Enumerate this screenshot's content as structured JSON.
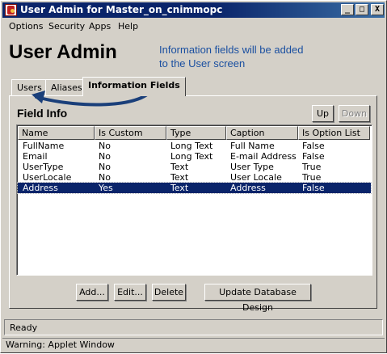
{
  "window": {
    "title": "User Admin for Master_on_cnimmopc",
    "minimize_glyph": "_",
    "maximize_glyph": "□",
    "close_glyph": "X"
  },
  "menu": [
    "Options",
    "Security",
    "Apps",
    "Help"
  ],
  "heading": "User Admin",
  "annotation": "Information fields will be added to the User screen",
  "tabs": [
    {
      "label": "Users",
      "active": false
    },
    {
      "label": "Aliases",
      "active": false
    },
    {
      "label": "Information Fields",
      "active": true
    }
  ],
  "panel": {
    "title": "Field Info",
    "up_label": "Up",
    "down_label": "Down"
  },
  "table": {
    "columns": [
      "Name",
      "Is Custom",
      "Type",
      "Caption",
      "Is Option List"
    ],
    "rows": [
      [
        "FullName",
        "No",
        "Long Text",
        "Full Name",
        "False"
      ],
      [
        "Email",
        "No",
        "Long Text",
        "E-mail Address",
        "False"
      ],
      [
        "UserType",
        "No",
        "Text",
        "User Type",
        "True"
      ],
      [
        "UserLocale",
        "No",
        "Text",
        "User Locale",
        "True"
      ],
      [
        "Address",
        "Yes",
        "Text",
        "Address",
        "False"
      ]
    ],
    "selected_row": 4
  },
  "buttons": {
    "add": "Add...",
    "edit": "Edit...",
    "delete": "Delete",
    "update": "Update Database Design"
  },
  "status": "Ready",
  "warning": "Warning: Applet Window",
  "colors": {
    "title_bar": "#0a246a",
    "selection": "#0a246a",
    "annotation": "#1a4fa0",
    "face": "#d4d0c8"
  }
}
